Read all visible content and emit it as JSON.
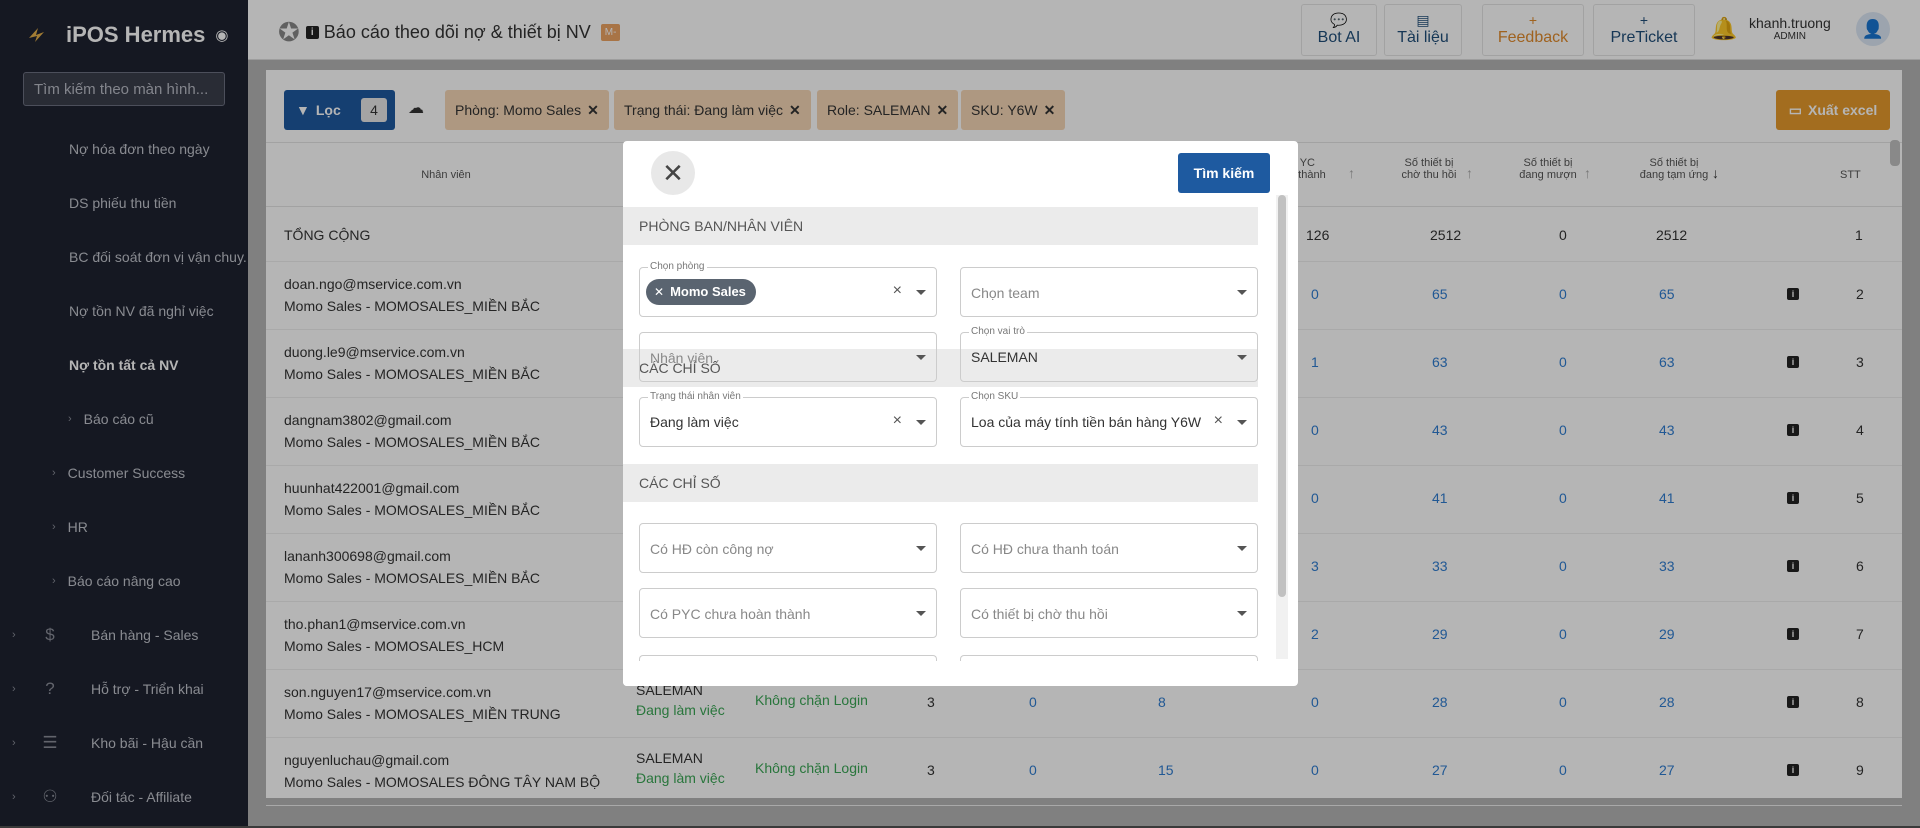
{
  "app": {
    "brand": "iPOS Hermes",
    "search_placeholder": "Tìm kiếm theo màn hình..."
  },
  "sidebar": {
    "items": [
      {
        "label": "Nợ hóa đơn theo ngày"
      },
      {
        "label": "DS phiếu thu tiền"
      },
      {
        "label": "BC đối soát đơn vị vận chuy..."
      },
      {
        "label": "Nợ tồn NV đã nghỉ việc"
      },
      {
        "label": "Nợ tồn tất cả NV"
      },
      {
        "label": "Báo cáo cũ"
      },
      {
        "label": "Customer Success"
      },
      {
        "label": "HR"
      },
      {
        "label": "Báo cáo nâng cao"
      }
    ],
    "groups": [
      {
        "label": "Bán hàng - Sales",
        "icon": "$"
      },
      {
        "label": "Hỗ trợ - Triển khai",
        "icon": "?"
      },
      {
        "label": "Kho bãi - Hậu cần",
        "icon": "☰"
      },
      {
        "label": "Đối tác - Affiliate",
        "icon": "⚇"
      }
    ]
  },
  "header": {
    "title": "Báo cáo theo dõi nợ & thiết bị NV",
    "tag": "M-",
    "buttons": {
      "bot": "Bot AI",
      "docs": "Tài liệu",
      "feedback": "Feedback",
      "preticket": "PreTicket"
    },
    "user": {
      "name": "khanh.truong",
      "role": "ADMIN"
    }
  },
  "filters": {
    "button": "Lọc",
    "count": "4",
    "chips": [
      "Phòng: Momo Sales",
      "Trạng thái: Đang làm việc",
      "Role: SALEMAN",
      "SKU: Y6W"
    ],
    "export": "Xuất excel"
  },
  "table": {
    "headers": {
      "nv": "Nhân viên",
      "pyc1": "YC",
      "pyc2": "n thành",
      "cho1": "Số thiết bị",
      "cho2": "chờ thu hồi",
      "muon1": "Số thiết bị",
      "muon2": "đang mượn",
      "ung1": "Số thiết bị",
      "ung2": "đang tạm ứng",
      "stt": "STT"
    },
    "total": {
      "label": "TỔNG CỘNG",
      "pyc": "126",
      "cho": "2512",
      "muon": "0",
      "ung": "2512",
      "stt": "1"
    },
    "rows": [
      {
        "email": "doan.ngo@mservice.com.vn",
        "dept": "Momo Sales - MOMOSALES_MIỀN BẮC",
        "pyc": "0",
        "cho": "65",
        "muon": "0",
        "ung": "65",
        "stt": "2"
      },
      {
        "email": "duong.le9@mservice.com.vn",
        "dept": "Momo Sales - MOMOSALES_MIỀN BẮC",
        "pyc": "1",
        "cho": "63",
        "muon": "0",
        "ung": "63",
        "stt": "3"
      },
      {
        "email": "dangnam3802@gmail.com",
        "dept": "Momo Sales - MOMOSALES_MIỀN BẮC",
        "pyc": "0",
        "cho": "43",
        "muon": "0",
        "ung": "43",
        "stt": "4"
      },
      {
        "email": "huunhat422001@gmail.com",
        "dept": "Momo Sales - MOMOSALES_MIỀN BẮC",
        "pyc": "0",
        "cho": "41",
        "muon": "0",
        "ung": "41",
        "stt": "5"
      },
      {
        "email": "lananh300698@gmail.com",
        "dept": "Momo Sales - MOMOSALES_MIỀN BẮC",
        "pyc": "3",
        "cho": "33",
        "muon": "0",
        "ung": "33",
        "stt": "6"
      },
      {
        "email": "tho.phan1@mservice.com.vn",
        "dept": "Momo Sales - MOMOSALES_HCM",
        "pyc": "2",
        "cho": "29",
        "muon": "0",
        "ung": "29",
        "stt": "7"
      },
      {
        "email": "son.nguyen17@mservice.com.vn",
        "dept": "Momo Sales - MOMOSALES_MIỀN TRUNG",
        "role": "SALEMAN",
        "status": "Đang làm việc",
        "login": "Không chặn Login",
        "c1": "3",
        "c2": "0",
        "c3": "8",
        "pyc": "0",
        "cho": "28",
        "muon": "0",
        "ung": "28",
        "stt": "8"
      },
      {
        "email": "nguyenluchau@gmail.com",
        "dept": "Momo Sales - MOMOSALES  ĐÔNG TÂY NAM BỘ",
        "role": "SALEMAN",
        "status": "Đang làm việc",
        "login": "Không chặn Login",
        "c1": "3",
        "c2": "0",
        "c3": "15",
        "pyc": "0",
        "cho": "27",
        "muon": "0",
        "ung": "27",
        "stt": "9"
      }
    ]
  },
  "modal": {
    "search": "Tìm kiếm",
    "section1": "PHÒNG BAN/NHÂN VIÊN",
    "section2": "CÁC CHỈ SỐ",
    "phong": {
      "label": "Chọn phòng",
      "chip": "Momo Sales"
    },
    "team": {
      "placeholder": "Chọn team"
    },
    "nhanvien": {
      "placeholder": "Nhân viên"
    },
    "vaitro": {
      "label": "Chọn vai trò",
      "value": "SALEMAN"
    },
    "trangthai": {
      "label": "Trạng thái nhân viên",
      "value": "Đang làm việc"
    },
    "sku": {
      "label": "Chọn SKU",
      "value": "Loa của máy tính tiền bán hàng Y6W"
    },
    "i1": {
      "placeholder": "Có HĐ còn công nợ"
    },
    "i2": {
      "placeholder": "Có HĐ chưa thanh toán"
    },
    "i3": {
      "placeholder": "Có PYC chưa hoàn thành"
    },
    "i4": {
      "placeholder": "Có thiết bị chờ thu hồi"
    }
  }
}
